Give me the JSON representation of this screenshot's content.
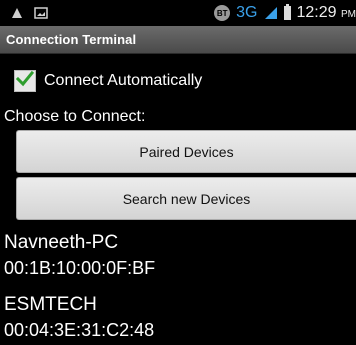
{
  "statusbar": {
    "network": "3G",
    "time": "12:29",
    "ampm": "PM"
  },
  "title": "Connection Terminal",
  "auto_connect": {
    "label": "Connect Automatically",
    "checked": true
  },
  "choose_label": "Choose to Connect:",
  "buttons": {
    "paired": "Paired Devices",
    "search": "Search new Devices"
  },
  "devices": [
    {
      "name": "Navneeth-PC",
      "address": "00:1B:10:00:0F:BF"
    },
    {
      "name": "ESMTECH",
      "address": "00:04:3E:31:C2:48"
    }
  ],
  "colors": {
    "accent": "#3aa0e8",
    "check": "#2e9e2e",
    "title_bar": "#5a5a5a",
    "background": "#000000"
  },
  "icons": [
    "notification-icon",
    "image-icon",
    "bluetooth-icon",
    "signal-icon",
    "battery-icon",
    "checkmark-icon"
  ]
}
